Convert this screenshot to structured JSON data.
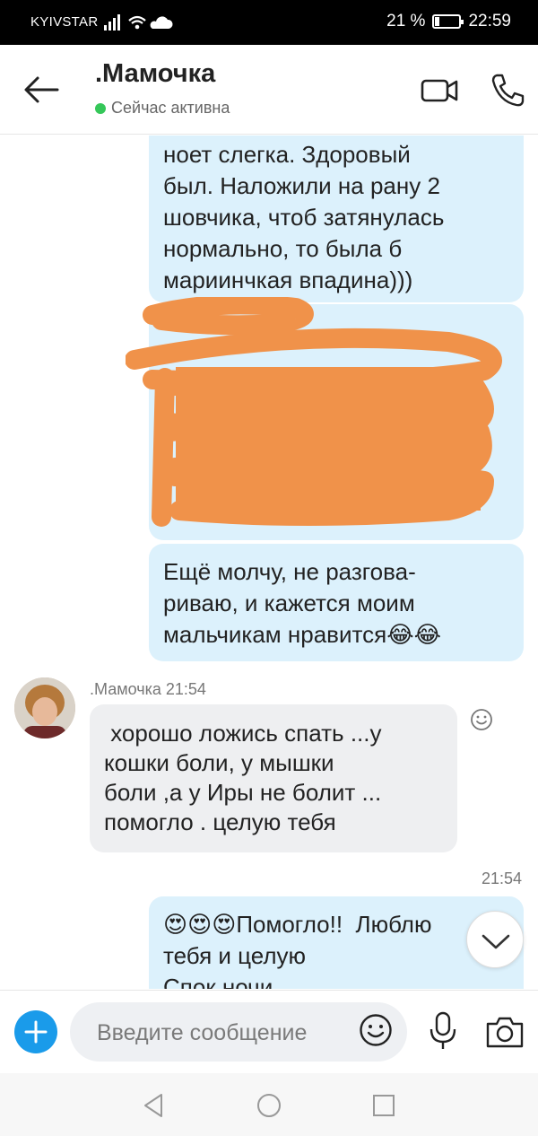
{
  "status_bar": {
    "carrier": "KYIVSTAR",
    "battery": "21 %",
    "battery_level": 0.21,
    "time": "22:59"
  },
  "header": {
    "title": ".Мамочка",
    "presence": "Сейчас активна"
  },
  "messages": {
    "out1": {
      "lines": [
        "ноет слегка. Здоровый",
        "был. Наложили на рану 2",
        "шовчика, чтоб затянулась",
        "нормально, то была б",
        "мариинчкая впадина)))"
      ]
    },
    "out3": {
      "lines": [
        "Ещё молчу, не разгова-",
        "риваю, и кажется моим",
        "мальчикам нравится😂😂"
      ]
    },
    "incoming": {
      "author_time": ".Мамочка 21:54",
      "lines": [
        " хорошо ложись спать ...у",
        "кошки боли, у мышки",
        "боли ,а у Иры не болит ...",
        "помогло . целую тебя"
      ]
    },
    "out4_time": "21:54",
    "out4": {
      "lines": [
        "😍😍😍Помогло!!  Люблю",
        "тебя и целую",
        "Спок ночи"
      ]
    }
  },
  "input": {
    "placeholder": "Введите сообщение"
  },
  "colors": {
    "outgoing_bubble": "#dcf1fc",
    "incoming_bubble": "#eeeff1",
    "accent": "#1a9bea",
    "presence_dot": "#35c759",
    "redaction": "#f0924a"
  }
}
